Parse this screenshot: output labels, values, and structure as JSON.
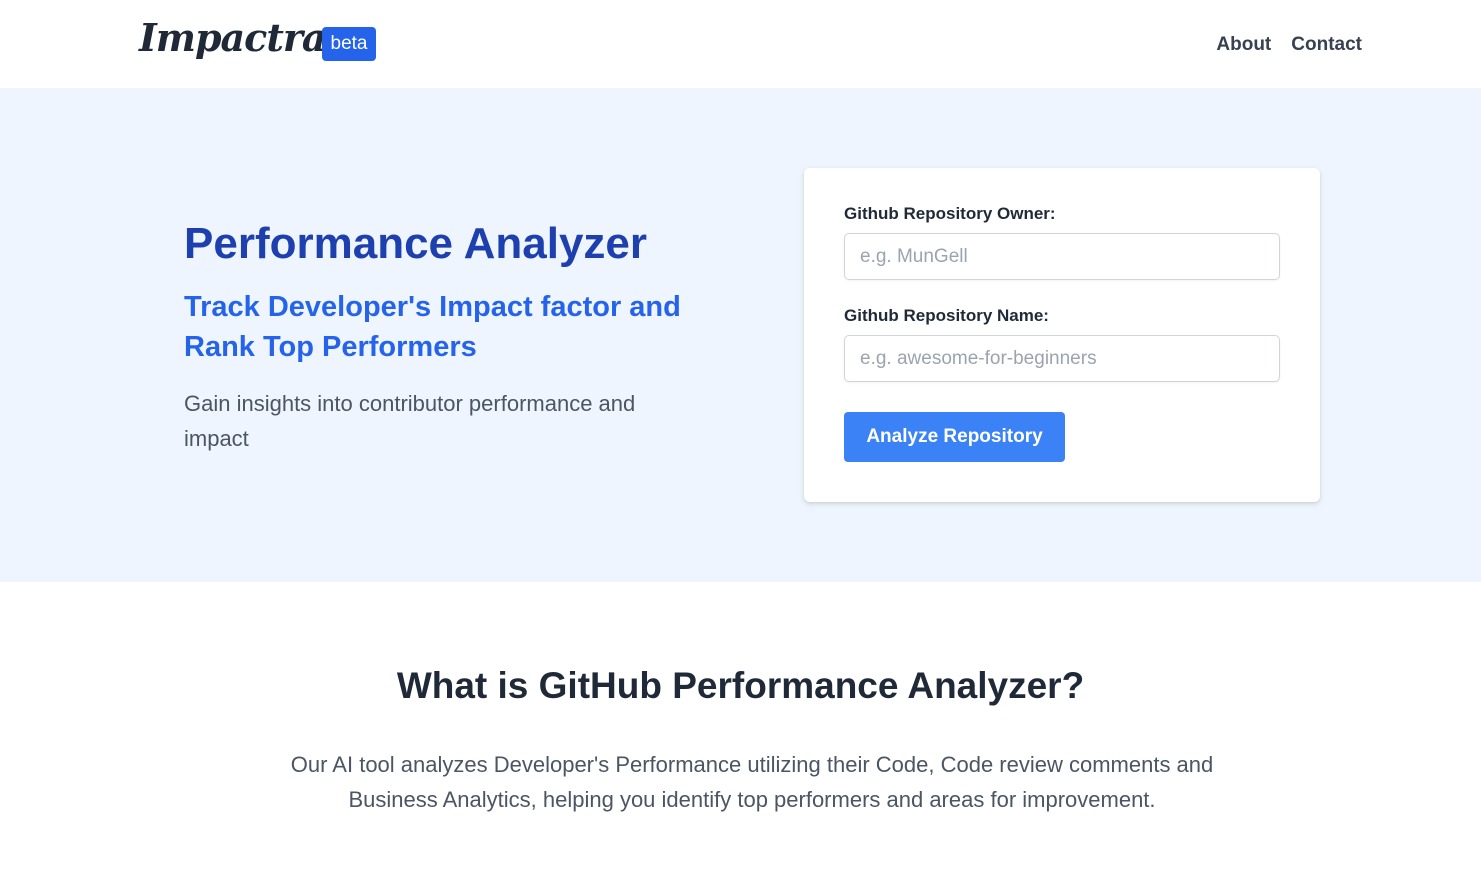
{
  "nav": {
    "logo": "Impactra",
    "badge": "beta",
    "links": [
      "About",
      "Contact"
    ]
  },
  "hero": {
    "title": "Performance Analyzer",
    "subtitle": "Track Developer's Impact factor and Rank Top Performers",
    "description": "Gain insights into contributor performance and impact"
  },
  "form": {
    "owner_label": "Github Repository Owner:",
    "owner_placeholder": "e.g. MunGell",
    "owner_value": "",
    "name_label": "Github Repository Name:",
    "name_placeholder": "e.g. awesome-for-beginners",
    "name_value": "",
    "submit_label": "Analyze Repository"
  },
  "about": {
    "title": "What is GitHub Performance Analyzer?",
    "description": "Our AI tool analyzes Developer's Performance utilizing their Code, Code review comments and Business Analytics, helping you identify top performers and areas for improvement."
  },
  "colors": {
    "brand": "#2563eb",
    "hero_bg": "#eef5fe",
    "title": "#1e40af",
    "button": "#3b82f6"
  }
}
